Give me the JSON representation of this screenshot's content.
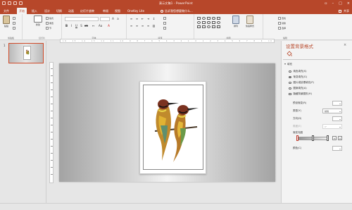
{
  "app": {
    "window_title": "演示文稿1 - PowerPoint"
  },
  "ribbon": {
    "tabs": [
      "文件",
      "开始",
      "插入",
      "设计",
      "切换",
      "动画",
      "幻灯片放映",
      "审阅",
      "视图",
      "OneKey Lite"
    ],
    "active_tab": "开始",
    "tell_me": "告诉我您想要做什么...",
    "share_label": "共享",
    "groups": {
      "clipboard": {
        "label": "剪贴板",
        "paste": "粘贴"
      },
      "slides": {
        "label": "幻灯片",
        "new_slide": "新建",
        "layout": "版式",
        "reset": "重置",
        "section": "节"
      },
      "font": {
        "label": "字体"
      },
      "paragraph": {
        "label": "段落"
      },
      "drawing": {
        "label": "绘图",
        "arrange": "排列",
        "quick_styles": "快速样式"
      },
      "editing": {
        "label": "编辑",
        "find": "查找",
        "replace": "替换",
        "select": "选择"
      }
    }
  },
  "thumbnails": [
    {
      "number": "1",
      "selected": true
    }
  ],
  "ruler": {
    "horizontal_ticks": "16 · 15 · 14 · 13 · 12 · 11 · 10 · 9 · 8 · 7 · 6 · 5 · 4 · 3 · 2 · 1 · 0 · 1 · 2 · 3 · 4 · 5 · 6 · 7 · 8 · 9 · 10 · 11 · 12 · 13 · 14 · 15 · 16"
  },
  "format_pane": {
    "title": "设置背景格式",
    "section": "填充",
    "fill_options": [
      {
        "label": "纯色填充(S)",
        "selected": false
      },
      {
        "label": "渐变填充(G)",
        "selected": true
      },
      {
        "label": "图片或纹理填充(P)",
        "selected": false
      },
      {
        "label": "图案填充(A)",
        "selected": false
      }
    ],
    "hide_bg_graphics": "隐藏背景图形(H)",
    "preset_gradient": "预设渐变(R)",
    "type_label": "类型(Y)",
    "type_value": "射线",
    "direction_label": "方向(D)",
    "angle_label": "角度(E)",
    "angle_value": "0°",
    "stops_label": "渐变光圈",
    "color_label": "颜色(C)"
  },
  "colors": {
    "brand": "#b7472a",
    "ribbon_bg": "#f3f3f3",
    "pane_bg": "#e6e6e6"
  }
}
